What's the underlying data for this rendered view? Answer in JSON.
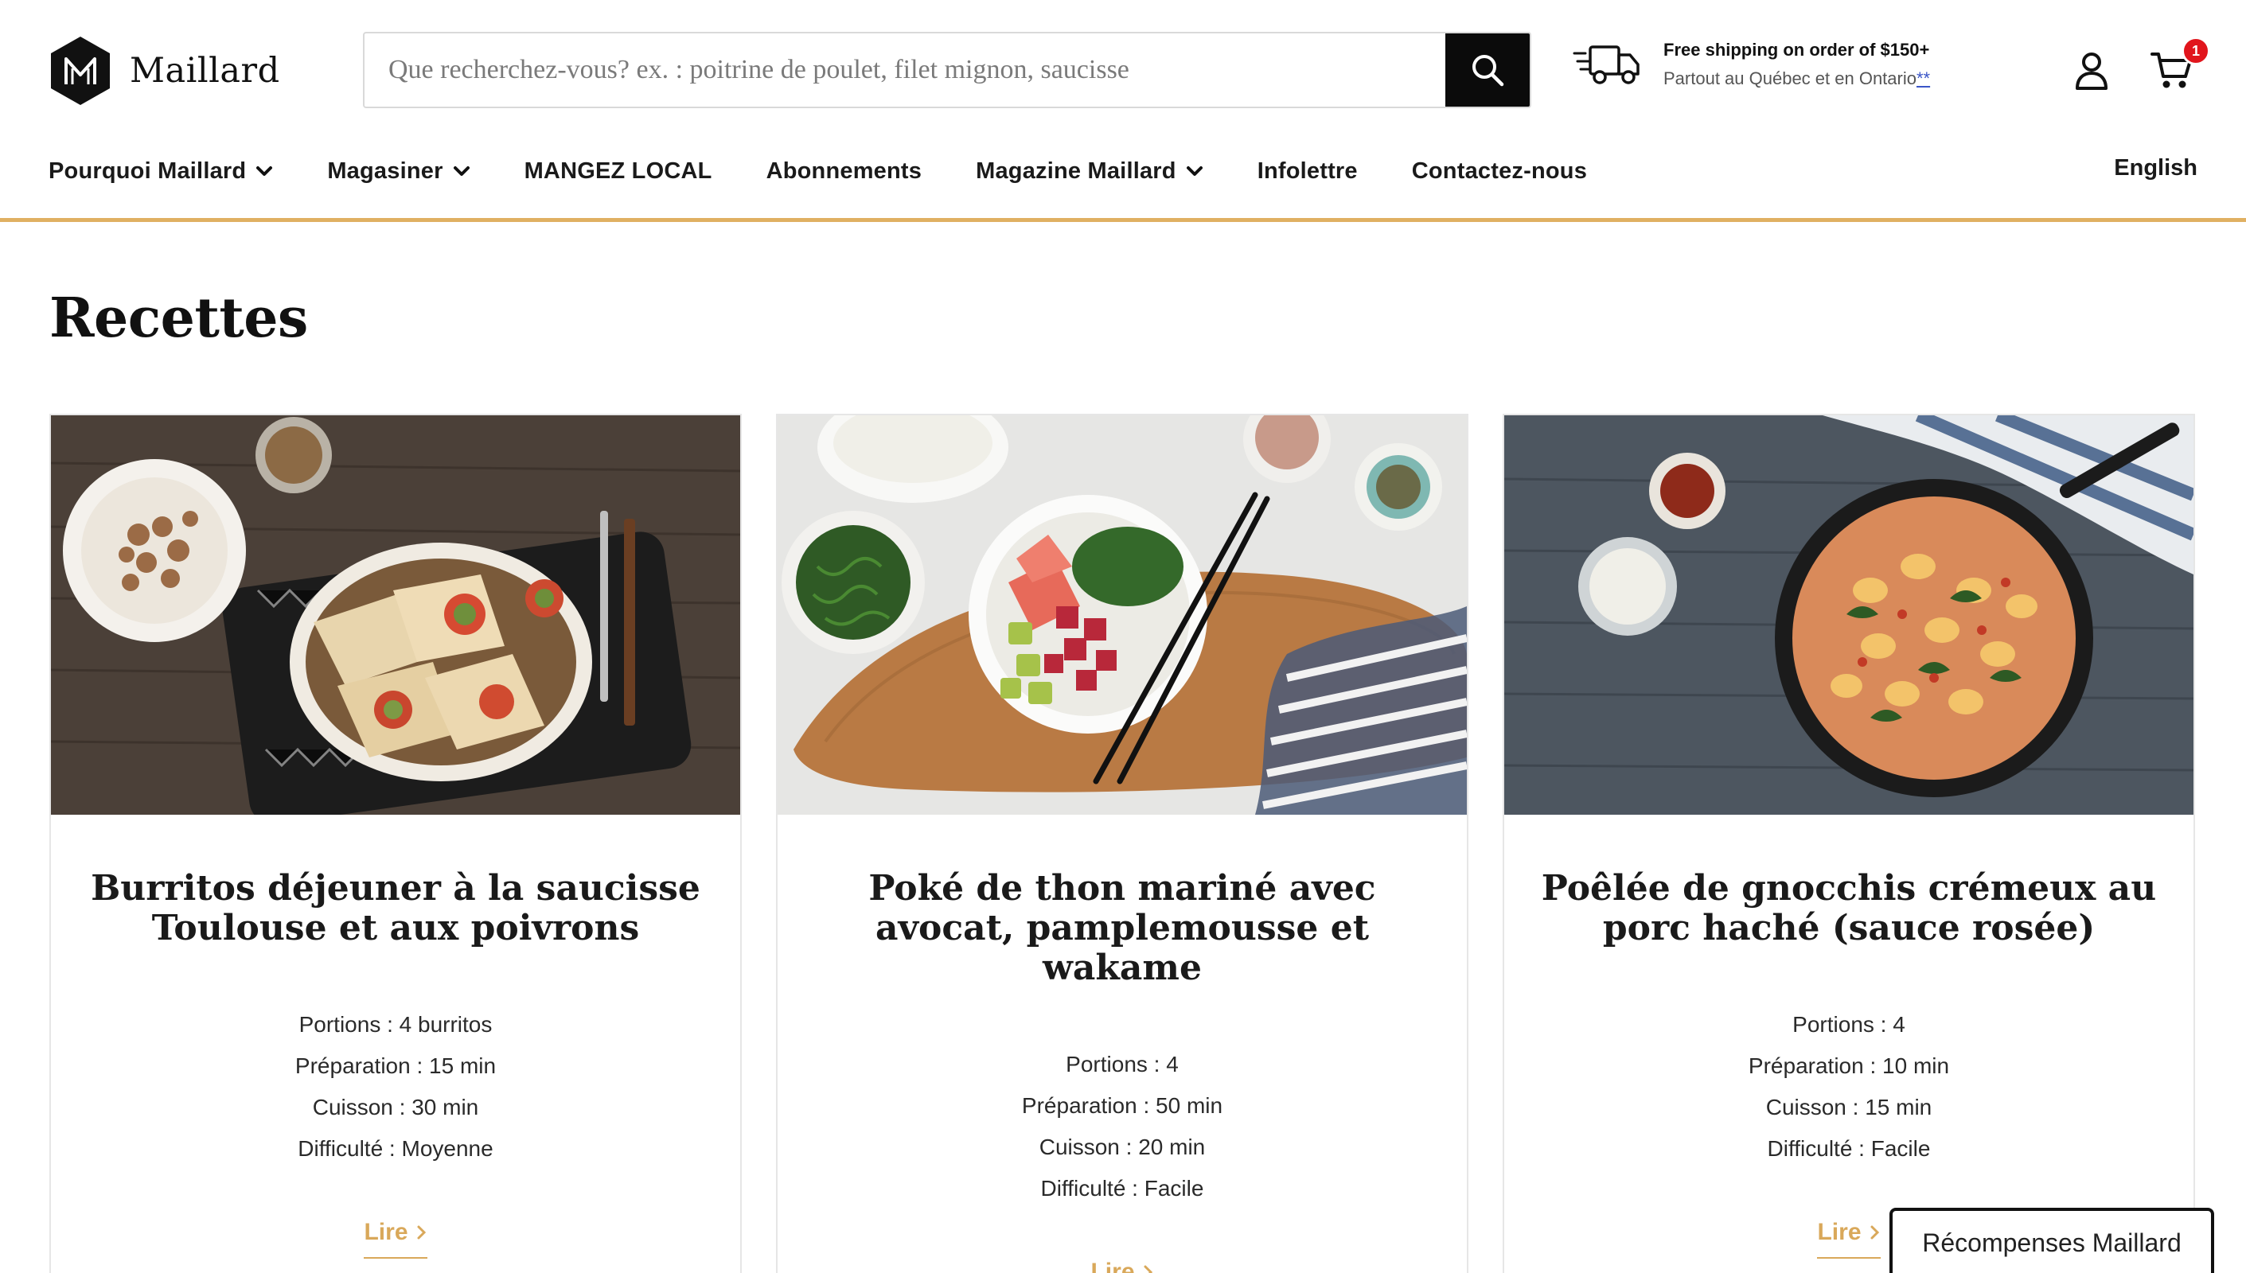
{
  "brand": {
    "name": "Maillard"
  },
  "search": {
    "placeholder": "Que recherchez-vous? ex. : poitrine de poulet, filet mignon, saucisse",
    "value": ""
  },
  "shipping": {
    "title": "Free shipping on order of $150+",
    "subtitle": "Partout au Québec et en Ontario",
    "link": "**"
  },
  "cart": {
    "count": "1"
  },
  "nav": {
    "items": [
      {
        "label": "Pourquoi Maillard",
        "dropdown": true
      },
      {
        "label": "Magasiner",
        "dropdown": true
      },
      {
        "label": "MANGEZ LOCAL",
        "dropdown": false
      },
      {
        "label": "Abonnements",
        "dropdown": false
      },
      {
        "label": "Magazine Maillard",
        "dropdown": true
      },
      {
        "label": "Infolettre",
        "dropdown": false
      },
      {
        "label": "Contactez-nous",
        "dropdown": false
      }
    ],
    "language": "English"
  },
  "page": {
    "title": "Recettes"
  },
  "recipes": [
    {
      "title": "Burritos déjeuner à la saucisse Toulouse et aux poivrons",
      "portions": "Portions : 4 burritos",
      "prep": "Préparation : 15 min",
      "cook": "Cuisson : 30 min",
      "difficulty": "Difficulté : Moyenne",
      "cta": "Lire"
    },
    {
      "title": "Poké de thon mariné avec avocat, pamplemousse et wakame",
      "portions": "Portions : 4",
      "prep": "Préparation : 50 min",
      "cook": "Cuisson : 20 min",
      "difficulty": "Difficulté : Facile",
      "cta": "Lire"
    },
    {
      "title": "Poêlée de gnocchis crémeux au porc haché (sauce rosée)",
      "portions": "Portions : 4",
      "prep": "Préparation : 10 min",
      "cook": "Cuisson : 15 min",
      "difficulty": "Difficulté : Facile",
      "cta": "Lire"
    }
  ],
  "rewards": {
    "label": "Récompenses Maillard"
  },
  "colors": {
    "accent": "#e0b062",
    "link_gold": "#d9a85a",
    "badge": "#e1151c",
    "search_button": "#0b0b0b"
  }
}
